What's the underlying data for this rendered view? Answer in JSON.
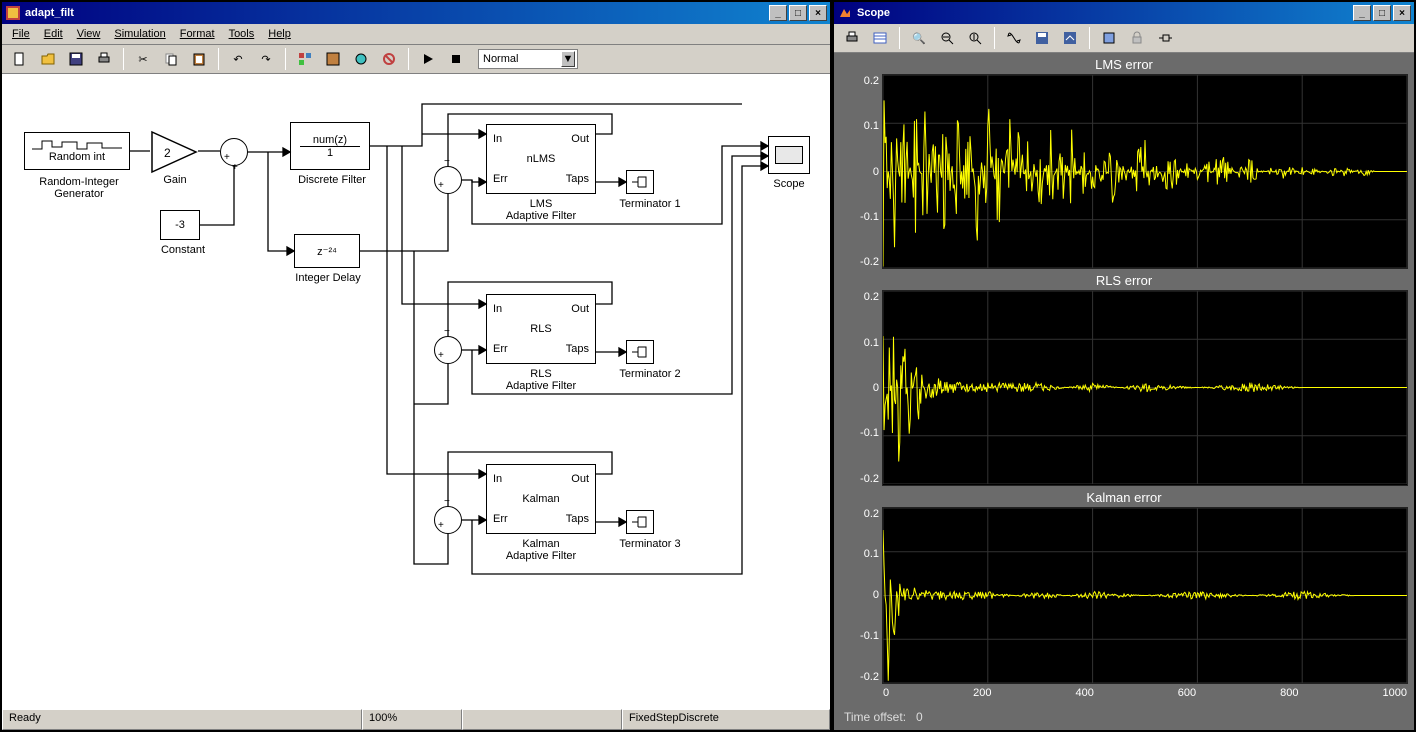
{
  "simulink": {
    "title": "adapt_filt",
    "menu": [
      "File",
      "Edit",
      "View",
      "Simulation",
      "Format",
      "Tools",
      "Help"
    ],
    "mode": "Normal",
    "status": {
      "ready": "Ready",
      "zoom": "100%",
      "solver": "FixedStepDiscrete"
    },
    "blocks": {
      "random_int": "Random int",
      "random_int_label": "Random-Integer\nGenerator",
      "gain_value": "2",
      "gain_label": "Gain",
      "constant_value": "-3",
      "constant_label": "Constant",
      "discrete_filter_num": "num(z)",
      "discrete_filter_den": "1",
      "discrete_filter_label": "Discrete Filter",
      "integer_delay_expr": "z⁻²⁴",
      "integer_delay_label": "Integer Delay",
      "lms_center": "nLMS",
      "lms_label": "LMS\nAdaptive Filter",
      "rls_center": "RLS",
      "rls_label": "RLS\nAdaptive Filter",
      "kalman_center": "Kalman",
      "kalman_label": "Kalman\nAdaptive Filter",
      "port_in": "In",
      "port_err": "Err",
      "port_out": "Out",
      "port_taps": "Taps",
      "term1": "Terminator 1",
      "term2": "Terminator 2",
      "term3": "Terminator 3",
      "scope_label": "Scope"
    }
  },
  "scope": {
    "title": "Scope",
    "footer_label": "Time offset:",
    "footer_value": "0",
    "plots": [
      {
        "title": "LMS error"
      },
      {
        "title": "RLS error"
      },
      {
        "title": "Kalman error"
      }
    ]
  },
  "chart_data": [
    {
      "type": "line",
      "title": "LMS error",
      "xlabel": "",
      "ylabel": "",
      "xlim": [
        0,
        1000
      ],
      "ylim": [
        -0.2,
        0.2
      ],
      "xticks": [
        0,
        200,
        400,
        600,
        800,
        1000
      ],
      "yticks": [
        -0.2,
        -0.1,
        0,
        0.1,
        0.2
      ],
      "series": [
        {
          "name": "error",
          "color": "#ffff00",
          "note": "noisy adaptive-filter error converging toward 0; large oscillation up to ~400 then decaying",
          "x": [
            0,
            20,
            40,
            60,
            80,
            100,
            120,
            140,
            160,
            180,
            200,
            220,
            240,
            260,
            280,
            300,
            320,
            340,
            360,
            380,
            400,
            420,
            440,
            460,
            480,
            500,
            520,
            540,
            560,
            580,
            600,
            620,
            640,
            660,
            680,
            700,
            720,
            740,
            760,
            780,
            800,
            820,
            840,
            860,
            880,
            900,
            920,
            940,
            960,
            980,
            1000
          ],
          "y": [
            0.2,
            -0.2,
            0.2,
            -0.2,
            0.2,
            -0.2,
            0.2,
            -0.19,
            0.19,
            -0.18,
            0.18,
            -0.15,
            0.14,
            -0.12,
            0.11,
            -0.1,
            0.1,
            -0.1,
            0.09,
            -0.08,
            0.07,
            -0.05,
            0.1,
            -0.05,
            0.04,
            0.07,
            -0.03,
            0.05,
            0.03,
            -0.02,
            0.02,
            -0.03,
            0.04,
            0.02,
            -0.02,
            0.03,
            0.01,
            -0.01,
            0.02,
            0.01,
            -0.01,
            0.01,
            0.0,
            0.01,
            -0.01,
            0.0,
            0.01,
            0.0,
            0.0,
            0.0,
            0.0
          ]
        }
      ]
    },
    {
      "type": "line",
      "title": "RLS error",
      "xlabel": "",
      "ylabel": "",
      "xlim": [
        0,
        1000
      ],
      "ylim": [
        -0.2,
        0.2
      ],
      "xticks": [
        0,
        200,
        400,
        600,
        800,
        1000
      ],
      "yticks": [
        -0.2,
        -0.1,
        0,
        0.1,
        0.2
      ],
      "series": [
        {
          "name": "error",
          "color": "#ffff00",
          "note": "short burst of large error then rapidly settles near 0",
          "x": [
            0,
            10,
            20,
            30,
            40,
            50,
            60,
            70,
            80,
            90,
            100,
            150,
            200,
            300,
            400,
            500,
            600,
            700,
            800,
            900,
            1000
          ],
          "y": [
            0.2,
            -0.2,
            0.2,
            -0.18,
            0.15,
            -0.1,
            0.06,
            0.08,
            -0.04,
            0.03,
            0.02,
            0.01,
            0.01,
            0.01,
            -0.01,
            0.01,
            0.0,
            0.01,
            0.0,
            0.0,
            0.0
          ]
        }
      ]
    },
    {
      "type": "line",
      "title": "Kalman error",
      "xlabel": "",
      "ylabel": "",
      "xlim": [
        0,
        1000
      ],
      "ylim": [
        -0.2,
        0.2
      ],
      "xticks": [
        0,
        200,
        400,
        600,
        800,
        1000
      ],
      "yticks": [
        -0.2,
        -0.1,
        0,
        0.1,
        0.2
      ],
      "series": [
        {
          "name": "error",
          "color": "#ffff00",
          "note": "very brief initial spike then ≈0 with tiny noise throughout",
          "x": [
            0,
            10,
            20,
            30,
            40,
            50,
            100,
            200,
            300,
            400,
            500,
            600,
            700,
            800,
            900,
            1000
          ],
          "y": [
            0.2,
            -0.2,
            0.15,
            -0.05,
            0.03,
            0.02,
            0.01,
            0.01,
            -0.01,
            0.01,
            0.0,
            0.01,
            0.0,
            0.01,
            0.0,
            0.0
          ]
        }
      ]
    }
  ]
}
